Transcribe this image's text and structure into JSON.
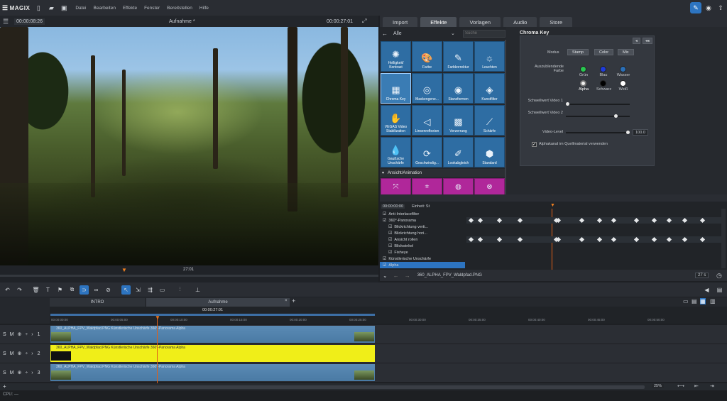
{
  "app": {
    "logo": "MAGIX",
    "menu": [
      "Datei",
      "Bearbeiten",
      "Effekte",
      "Fenster",
      "Bereitstellen",
      "Hilfe"
    ]
  },
  "preview": {
    "time_left": "00:00:08:26",
    "title": "Aufnahme *",
    "time_right": "00:00:27:01",
    "scrub_time": "27:01"
  },
  "tabs": [
    "Import",
    "Effekte",
    "Vorlagen",
    "Audio",
    "Store"
  ],
  "effects": {
    "category": "Alle",
    "search_placeholder": "Suche",
    "section": "Ansicht/Animation",
    "tiles": [
      {
        "label": "Helligkeit/ Kontrast",
        "icon": "✺"
      },
      {
        "label": "Farbe",
        "icon": "🎨"
      },
      {
        "label": "Farbkorrektur",
        "icon": "✎"
      },
      {
        "label": "Leuchten",
        "icon": "☼"
      },
      {
        "label": "Chroma Key",
        "icon": "▦"
      },
      {
        "label": "Maskengene...",
        "icon": "◎"
      },
      {
        "label": "Stanzformen",
        "icon": "◉"
      },
      {
        "label": "Kunstfilter",
        "icon": "◈"
      },
      {
        "label": "VEGAS Video Stabilization",
        "icon": "✋"
      },
      {
        "label": "Linsenreflexion",
        "icon": "◁"
      },
      {
        "label": "Verzerrung",
        "icon": "▩"
      },
      {
        "label": "Schärfe",
        "icon": "⟋"
      },
      {
        "label": "Gaußsche Unschärfe",
        "icon": "💧"
      },
      {
        "label": "Geschwindig...",
        "icon": "⟳"
      },
      {
        "label": "Lookabgleich",
        "icon": "✐"
      },
      {
        "label": "Standard",
        "icon": "⬢"
      }
    ]
  },
  "chroma": {
    "title": "Chroma Key",
    "modus_label": "Modus",
    "modes": [
      "Stamp",
      "Color",
      "Mix"
    ],
    "exclude_label": "Auszublendende Farbe",
    "colors": [
      {
        "name": "Grün",
        "hex": "#28c850"
      },
      {
        "name": "Blau",
        "hex": "#1e3cdc"
      },
      {
        "name": "Wasser",
        "hex": "#2a6fb8"
      },
      {
        "name": "Alpha",
        "hex": "#f0f0f0"
      },
      {
        "name": "Schwarz",
        "hex": "#000000"
      },
      {
        "name": "Weiß",
        "hex": "#ffffff"
      }
    ],
    "threshold1": "Schwellwert Video 1",
    "threshold2": "Schwellwert Video 2",
    "video_level_label": "Video-Level",
    "video_level_value": "100.0",
    "video_level": 1.0,
    "threshold1_level": 0.0,
    "threshold2_level": 0.8,
    "alpha_checkbox": "Alphakanal im Quellmaterial verwenden"
  },
  "keyframes": {
    "time": "00:00:00:00",
    "unit_label": "Einheit: St",
    "rows": [
      "Anti-Interlacefilter",
      "360°-Panorama",
      "Blickrichtung verti...",
      "Blickrichtung hori...",
      "Ansicht rollen",
      "Blickwinkel",
      "Fisheye",
      "Künstlerische Unschärfe",
      "Alpha"
    ],
    "bottom_file": "360_ALPHA_FPV_Waldpfad.PNG",
    "zoom": "27 s"
  },
  "timeline": {
    "tabs": [
      "INTRO",
      "Aufnahme"
    ],
    "playhead_time": "00:00:27:01",
    "ticks": [
      "00:00:00:00",
      "00:00:05:00",
      "00:00:10:00",
      "00:00:15:00",
      "00:00:20:00",
      "00:00:25:00",
      "00:00:30:00",
      "00:00:35:00",
      "00:00:40:00",
      "00:00:45:00",
      "00:00:50:00"
    ],
    "tracks": [
      {
        "num": "1",
        "clip": "360_ALPHA_FPV_Waldpfad.PNG  Künstlerische Unschärfe  360°-Panorama  Alpha"
      },
      {
        "num": "2",
        "clip": "360_ALPHA_FPV_Waldpfad.PNG  Künstlerische Unschärfe  360°-Panorama Alpha"
      },
      {
        "num": "3",
        "clip": "360_ALPHA_FPV_Waldpfad.PNG  Künstlerische Unschärfe  360°-Panorama  Alpha"
      }
    ],
    "zoom": "25%",
    "cpu": "CPU: —"
  }
}
